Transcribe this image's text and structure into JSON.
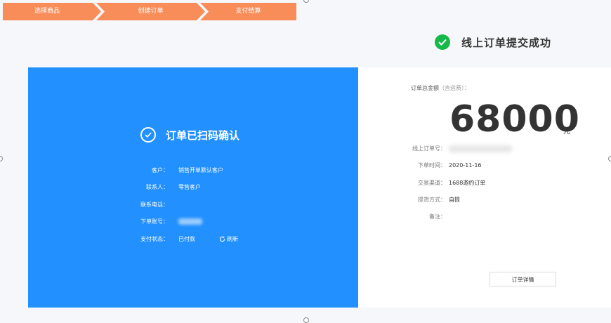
{
  "steps": [
    {
      "label": "选择商品"
    },
    {
      "label": "创建订单"
    },
    {
      "label": "支付结算"
    }
  ],
  "success": {
    "title": "线上订单提交成功"
  },
  "scan_panel": {
    "heading": "订单已扫码确认",
    "rows": [
      {
        "label": "客户：",
        "value": "销售开单默认客户"
      },
      {
        "label": "联系人：",
        "value": "零售客户"
      },
      {
        "label": "联系电话：",
        "value": ""
      },
      {
        "label": "下单账号：",
        "value": ""
      },
      {
        "label": "支付状态：",
        "value": "已付款"
      }
    ],
    "refresh_label": "刷新"
  },
  "summary": {
    "total_label": "订单总金额",
    "total_note": "（含运费）：",
    "amount": "68000",
    "unit": "元",
    "fields": [
      {
        "key": "线上订单号：",
        "value": ""
      },
      {
        "key": "下单时间：",
        "value": "2020-11-16"
      },
      {
        "key": "交易渠道：",
        "value": "1688邀约订单"
      },
      {
        "key": "提货方式：",
        "value": "自提"
      },
      {
        "key": "备注：",
        "value": ""
      }
    ],
    "detail_button": "订单详情"
  },
  "colors": {
    "step_orange": "#f98d5a",
    "panel_blue": "#2290ff",
    "success_green": "#16b84a"
  }
}
